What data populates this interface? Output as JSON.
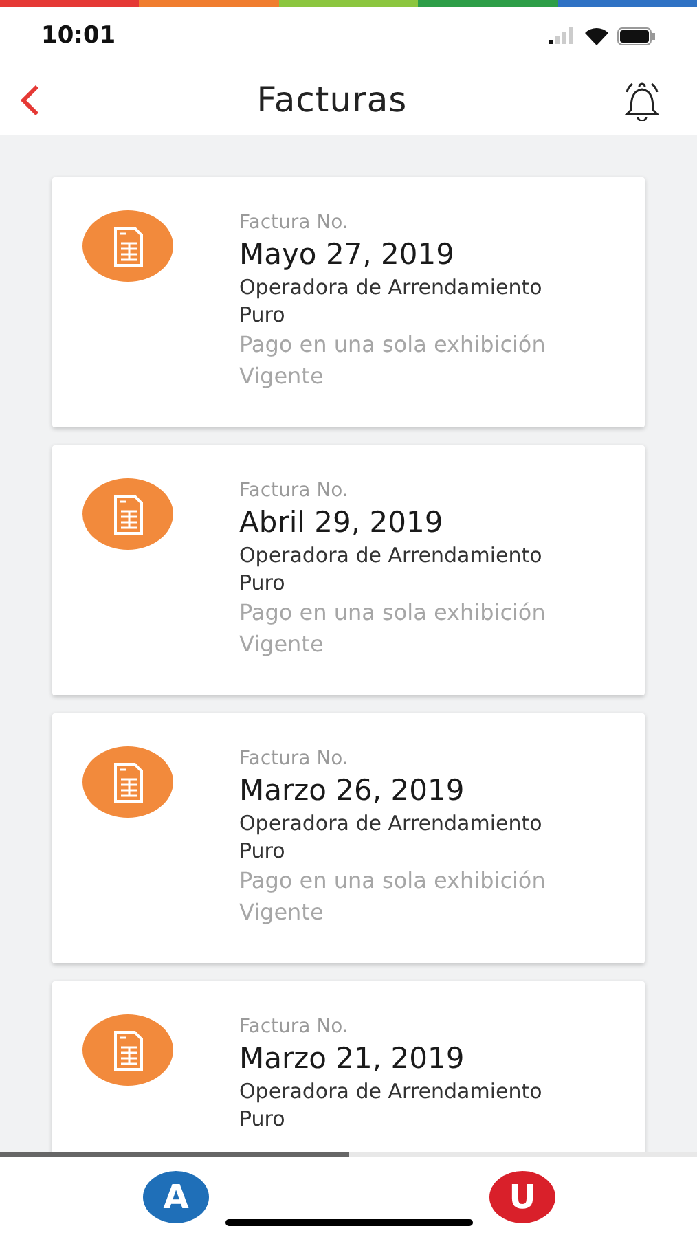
{
  "status_bar": {
    "time": "10:01"
  },
  "header": {
    "title": "Facturas"
  },
  "invoices": [
    {
      "label": "Factura No.",
      "date": "Mayo 27, 2019",
      "company": "Operadora de Arrendamiento Puro",
      "payment": "Pago en una sola exhibición",
      "status": "Vigente"
    },
    {
      "label": "Factura No.",
      "date": "Abril 29, 2019",
      "company": "Operadora de Arrendamiento Puro",
      "payment": "Pago en una sola exhibición",
      "status": "Vigente"
    },
    {
      "label": "Factura No.",
      "date": "Marzo 26, 2019",
      "company": "Operadora de Arrendamiento Puro",
      "payment": "Pago en una sola exhibición",
      "status": "Vigente"
    },
    {
      "label": "Factura No.",
      "date": "Marzo 21, 2019",
      "company": "Operadora de Arrendamiento Puro"
    }
  ],
  "progress": {
    "level": 0.5
  },
  "bottom_bar": [
    {
      "letter": "A",
      "color": "#1f6fb8"
    },
    {
      "letter": "U",
      "color": "#d9202a"
    }
  ]
}
